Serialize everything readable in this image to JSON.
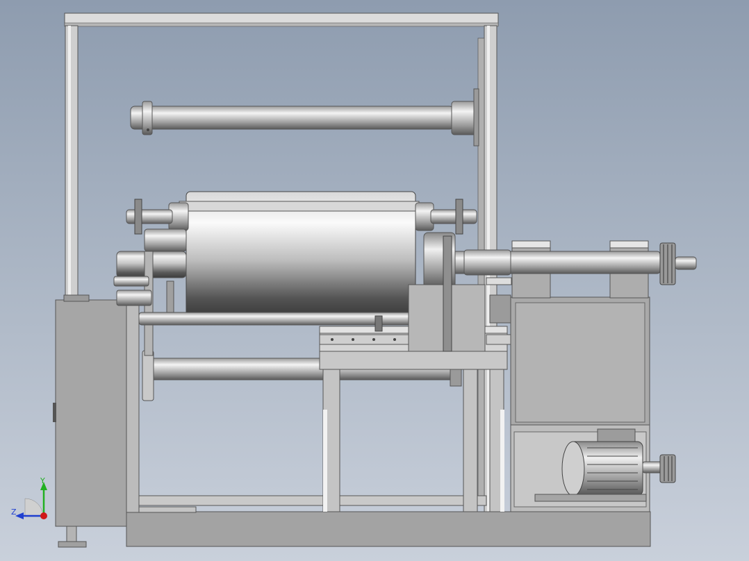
{
  "viewport": {
    "background_top": "#8e9caf",
    "background_bottom": "#c9d0db"
  },
  "model": {
    "description_icon": "machine-assembly-icon",
    "metal_color": "#b8b8b8",
    "dark_metal_color": "#6e6e6e",
    "panel_color": "#a3a3a3"
  },
  "triad": {
    "y_label": "Y",
    "z_label": "Z",
    "y_color": "#21b021",
    "z_color": "#2040d0",
    "x_color": "#d01818"
  }
}
